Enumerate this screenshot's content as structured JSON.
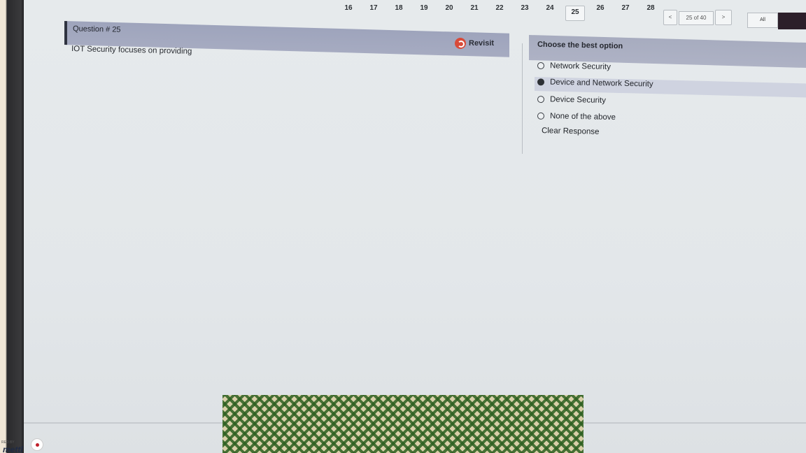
{
  "pager": {
    "numbers": [
      "16",
      "17",
      "18",
      "19",
      "20",
      "21",
      "22",
      "23",
      "24",
      "25",
      "26",
      "27",
      "28"
    ],
    "current": "25",
    "prev_label": "<",
    "page_of": "25 of 40",
    "next_label": ">",
    "all_label": "All"
  },
  "question": {
    "title": "Question # 25",
    "text": "IOT Security focuses on providing",
    "revisit_label": "Revisit"
  },
  "options_panel": {
    "title": "Choose the best option",
    "options": [
      {
        "label": "Network Security",
        "selected": false
      },
      {
        "label": "Device and Network Security",
        "selected": true
      },
      {
        "label": "Device Security",
        "selected": false
      },
      {
        "label": "None of the above",
        "selected": false
      }
    ],
    "clear_label": "Clear Response"
  },
  "branding": {
    "small": "RED BY",
    "name": "mettl"
  },
  "colors": {
    "header_band": "#a6abc1",
    "revisit_icon": "#d84b3a",
    "selected_row": "#cfd3e0"
  }
}
